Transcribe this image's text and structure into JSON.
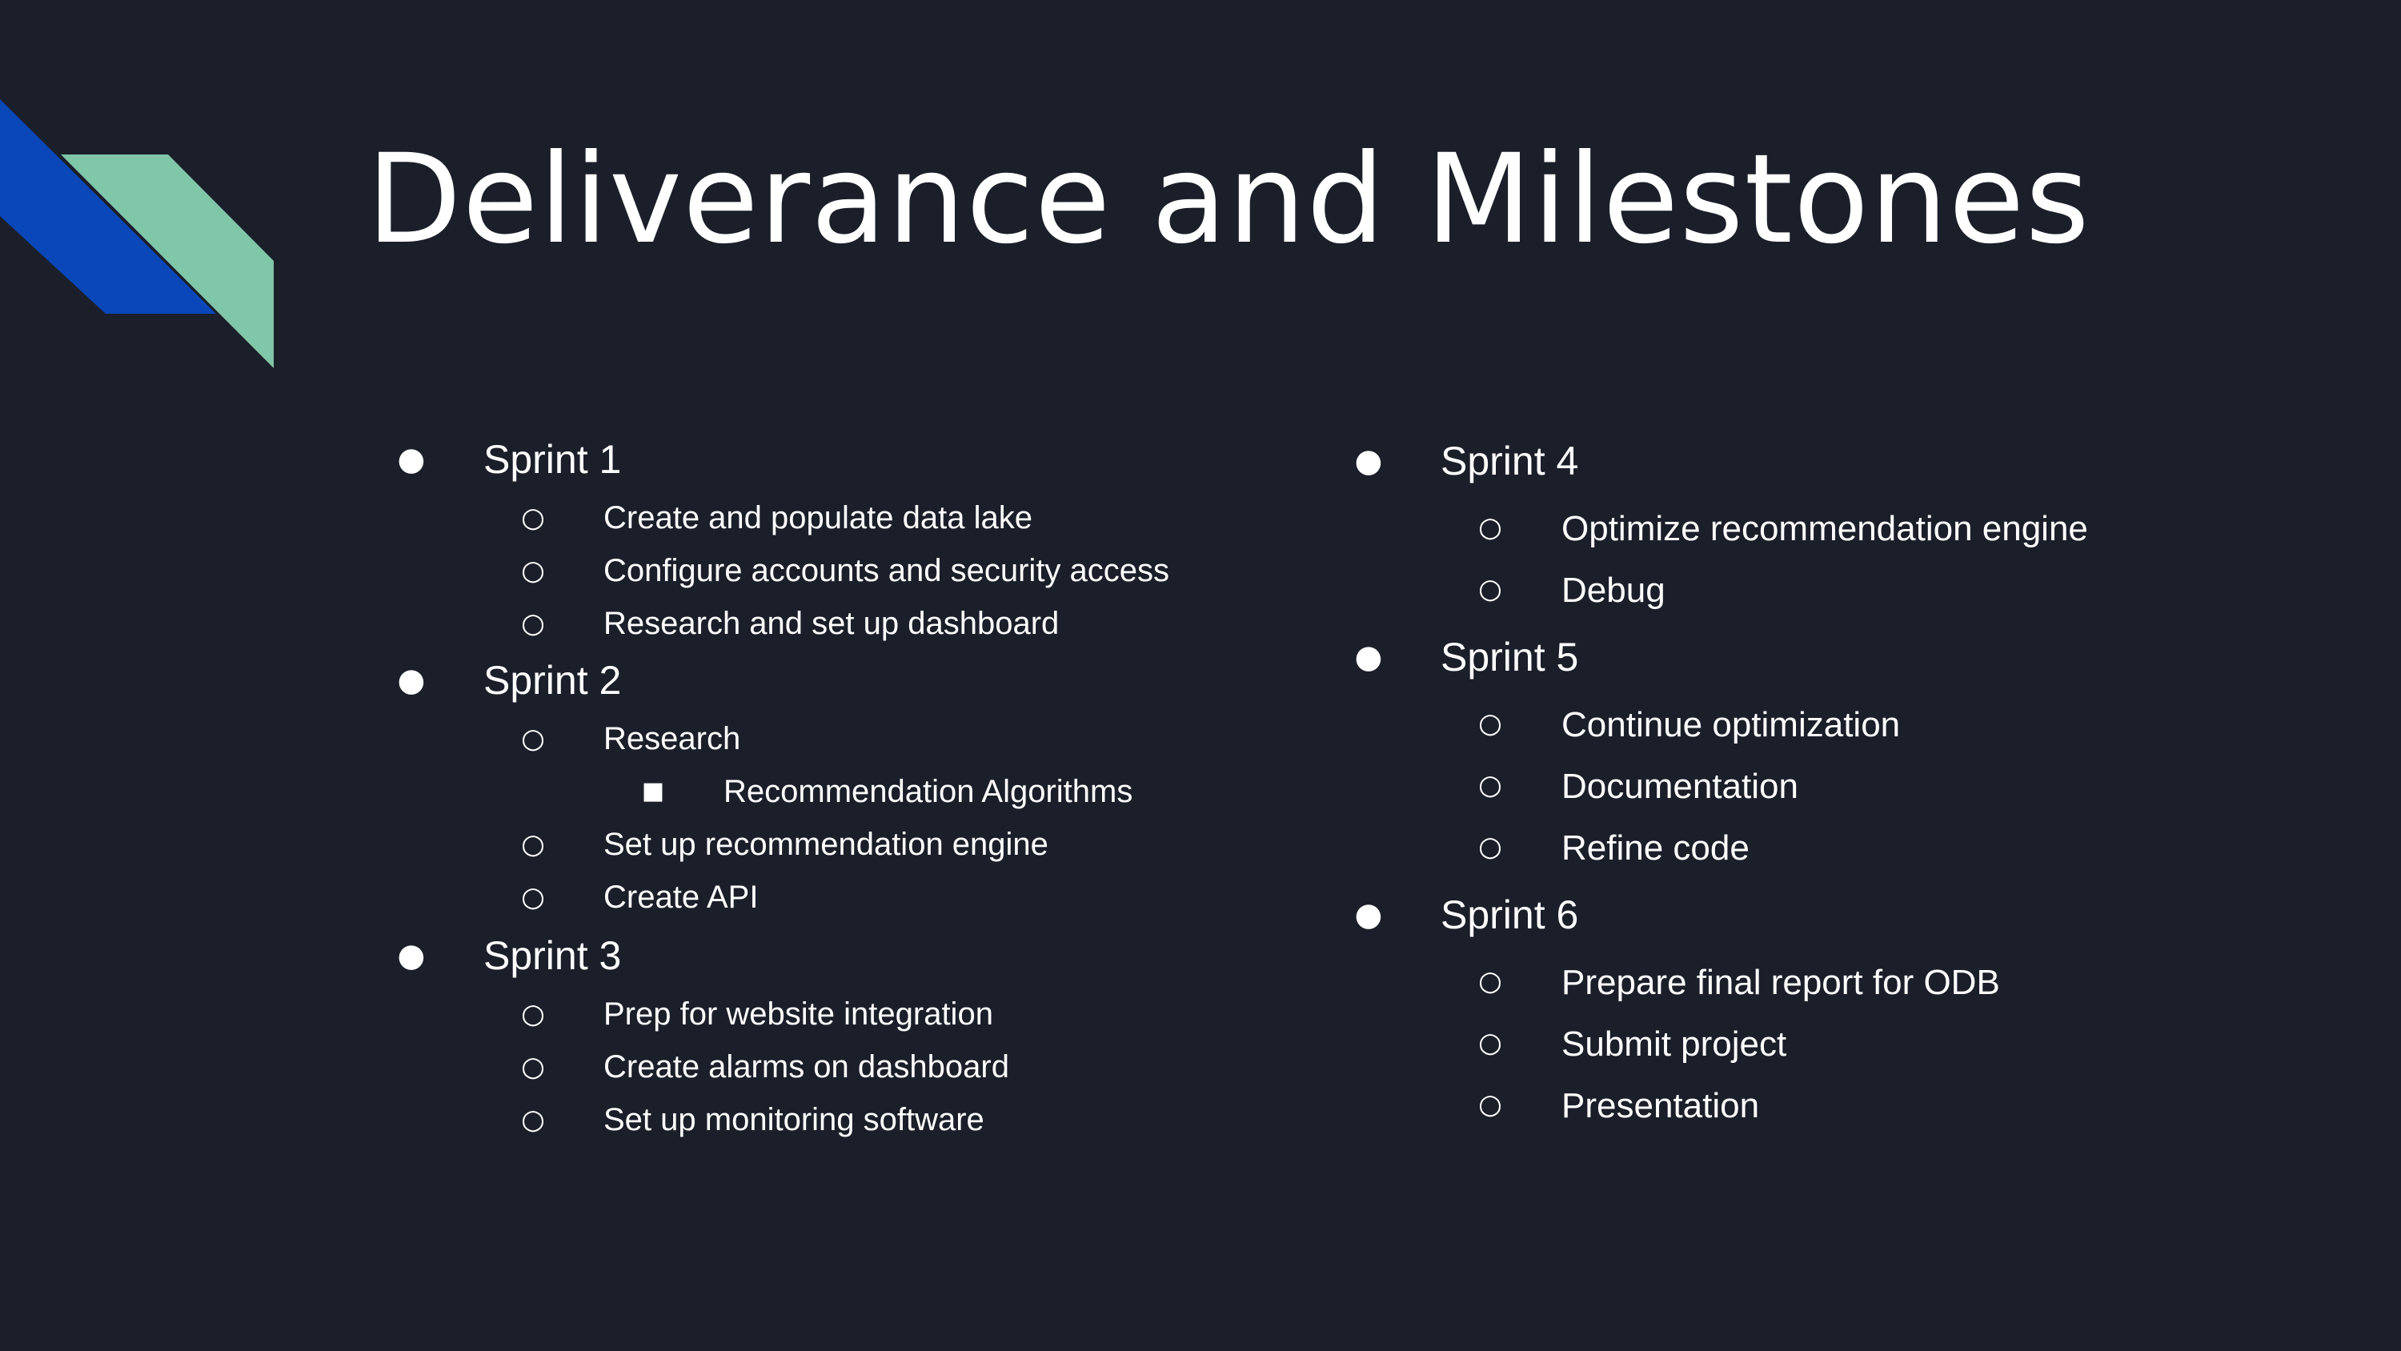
{
  "slide": {
    "title": "Deliverance and Milestones",
    "colors": {
      "background": "#1b1f2a",
      "accent_blue": "#0a47b8",
      "accent_green": "#80c6a8",
      "text": "#ffffff"
    },
    "bullet_icons": {
      "level1": "filled-circle-bullet",
      "level2": "hollow-circle-bullet",
      "level3": "filled-square-bullet"
    },
    "left_column": [
      {
        "label": "Sprint 1",
        "items": [
          {
            "label": "Create and populate data lake"
          },
          {
            "label": "Configure accounts and security access"
          },
          {
            "label": "Research and set up dashboard"
          }
        ]
      },
      {
        "label": "Sprint 2",
        "items": [
          {
            "label": "Research",
            "subitems": [
              "Recommendation Algorithms"
            ]
          },
          {
            "label": "Set up recommendation engine"
          },
          {
            "label": "Create API"
          }
        ]
      },
      {
        "label": "Sprint 3",
        "items": [
          {
            "label": "Prep for website integration"
          },
          {
            "label": "Create alarms on dashboard"
          },
          {
            "label": "Set up monitoring software"
          }
        ]
      }
    ],
    "right_column": [
      {
        "label": "Sprint 4",
        "items": [
          {
            "label": "Optimize recommendation engine"
          },
          {
            "label": "Debug"
          }
        ]
      },
      {
        "label": "Sprint 5",
        "items": [
          {
            "label": "Continue optimization"
          },
          {
            "label": "Documentation"
          },
          {
            "label": "Refine code"
          }
        ]
      },
      {
        "label": "Sprint 6",
        "items": [
          {
            "label": "Prepare final report for ODB"
          },
          {
            "label": "Submit project"
          },
          {
            "label": "Presentation"
          }
        ]
      }
    ]
  }
}
